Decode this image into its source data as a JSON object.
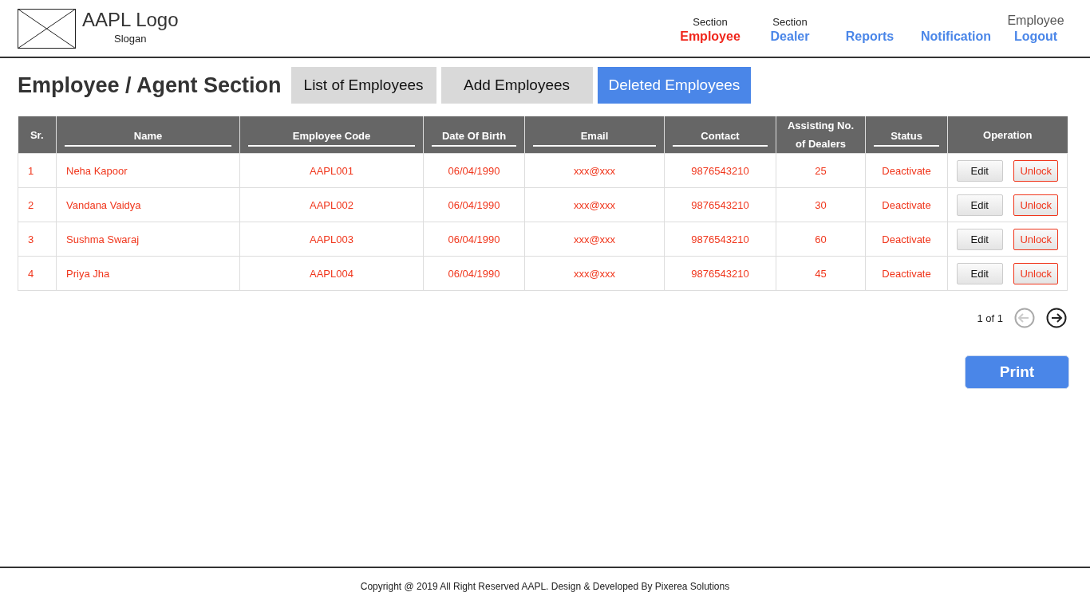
{
  "header": {
    "logo": "AAPL Logo",
    "slogan": "Slogan",
    "nav": [
      {
        "caption": "Section",
        "label": "Employee",
        "selected": true
      },
      {
        "caption": "Section",
        "label": "Dealer",
        "selected": false
      },
      {
        "label": "Reports",
        "selected": false
      },
      {
        "label": "Notification",
        "selected": false
      }
    ],
    "user": {
      "name": "Employee",
      "logout": "Logout"
    }
  },
  "page_title": "Employee / Agent Section",
  "tabs": [
    {
      "label": "List of Employees",
      "selected": false
    },
    {
      "label": "Add Employees",
      "selected": false
    },
    {
      "label": "Deleted Employees",
      "selected": true
    }
  ],
  "table": {
    "columns": [
      {
        "label": "Sr.",
        "underlined": false
      },
      {
        "label": "Name",
        "underlined": true
      },
      {
        "label": "Employee Code",
        "underlined": true
      },
      {
        "label": "Date Of Birth",
        "underlined": true
      },
      {
        "label": "Email",
        "underlined": true
      },
      {
        "label": "Contact",
        "underlined": true
      },
      {
        "label": "Assisting No. of Dealers",
        "underlined": false
      },
      {
        "label": "Status",
        "underlined": true
      },
      {
        "label": "Operation",
        "underlined": false
      }
    ],
    "rows": [
      {
        "sr": "1",
        "name": "Neha Kapoor",
        "code": "AAPL001",
        "dob": "06/04/1990",
        "email": "xxx@xxx",
        "contact": "9876543210",
        "dealers": "25",
        "status": "Deactivate",
        "actions": [
          "Edit",
          "Unlock"
        ]
      },
      {
        "sr": "2",
        "name": "Vandana Vaidya",
        "code": "AAPL002",
        "dob": "06/04/1990",
        "email": "xxx@xxx",
        "contact": "9876543210",
        "dealers": "30",
        "status": "Deactivate",
        "actions": [
          "Edit",
          "Unlock"
        ]
      },
      {
        "sr": "3",
        "name": "Sushma Swaraj",
        "code": "AAPL003",
        "dob": "06/04/1990",
        "email": "xxx@xxx",
        "contact": "9876543210",
        "dealers": "60",
        "status": "Deactivate",
        "actions": [
          "Edit",
          "Unlock"
        ]
      },
      {
        "sr": "4",
        "name": "Priya Jha",
        "code": "AAPL004",
        "dob": "06/04/1990",
        "email": "xxx@xxx",
        "contact": "9876543210",
        "dealers": "45",
        "status": "Deactivate",
        "actions": [
          "Edit",
          "Unlock"
        ]
      }
    ]
  },
  "pagination": {
    "text": "1 of 1",
    "prev_disabled": true,
    "next_disabled": false
  },
  "print_button": "Print",
  "footer": "Copyright @ 2019 All Right Reserved AAPL. Design & Developed By Pixerea Solutions"
}
